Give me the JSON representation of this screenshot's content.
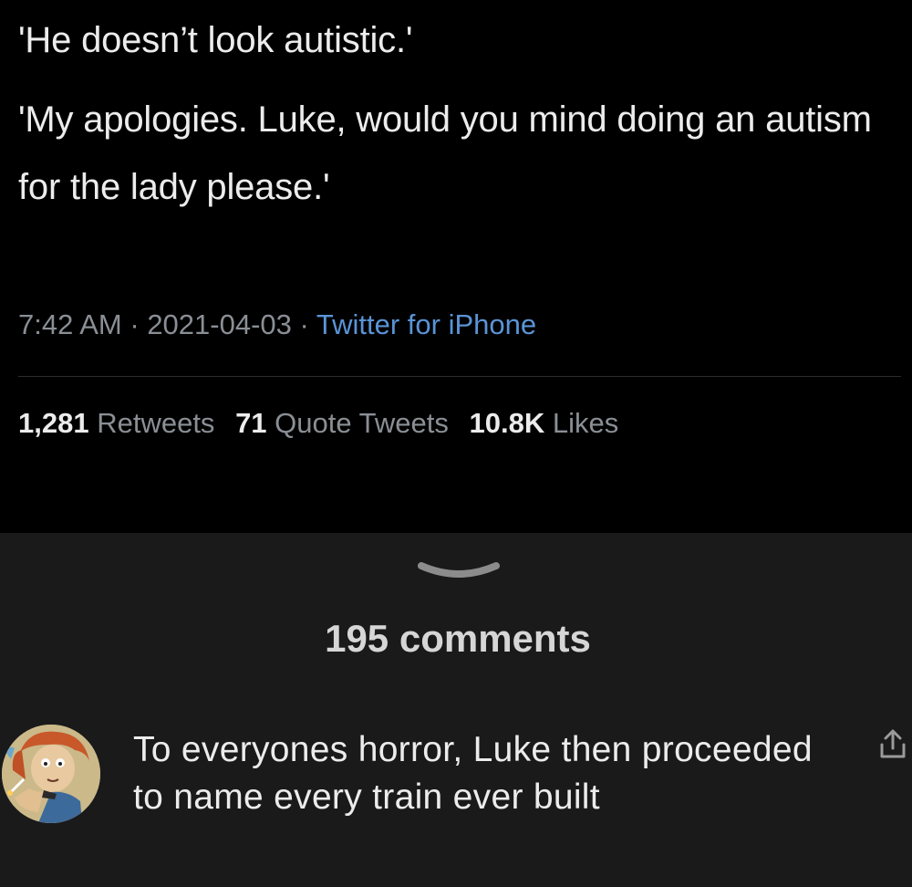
{
  "tweet": {
    "line1": "'He doesn’t look autistic.'",
    "line2": "'My apologies. Luke, would you mind doing an autism for the lady please.'",
    "time": "7:42 AM",
    "sep1": " · ",
    "date": "2021-04-03",
    "sep2": " · ",
    "source": "Twitter for iPhone",
    "stats": {
      "retweets_num": "1,281",
      "retweets_label": "Retweets",
      "quotes_num": "71",
      "quotes_label": "Quote Tweets",
      "likes_num": "10.8K",
      "likes_label": "Likes"
    }
  },
  "comments": {
    "count_label": "195 comments",
    "items": [
      {
        "text": "To everyones horror, Luke then proceeded to name every train ever built",
        "avatar_icon": "cartoon-avatar-icon",
        "share_icon": "share-icon"
      }
    ]
  },
  "colors": {
    "background": "#000000",
    "sheet": "#1a1a1b",
    "text": "#ececec",
    "muted": "#8a8f95",
    "link": "#5a94d6"
  }
}
